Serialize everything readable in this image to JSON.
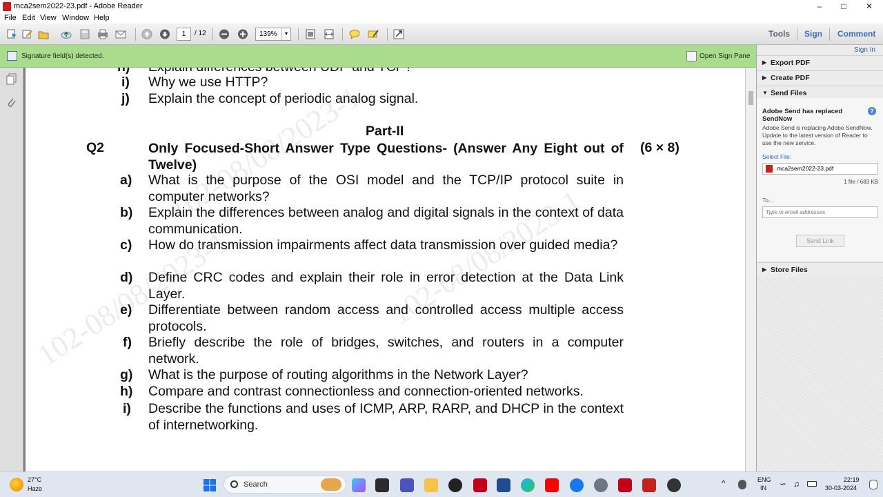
{
  "window": {
    "title": "mca2sem2022-23.pdf - Adobe Reader"
  },
  "menu": [
    "File",
    "Edit",
    "View",
    "Window",
    "Help"
  ],
  "toolbar": {
    "page_current": "1",
    "page_total": "/ 12",
    "zoom": "139%",
    "tools_label": "Tools",
    "sign_label": "Sign",
    "comment_label": "Comment"
  },
  "notification": {
    "message": "Signature field(s) detected.",
    "open_sign_pane": "Open Sign Pane"
  },
  "document": {
    "partial_top": "Explain differences between UDP and TCP?",
    "partial_top_label": "h)",
    "items_top": [
      {
        "label": "i)",
        "text": "Why we use HTTP?"
      },
      {
        "label": "j)",
        "text": "Explain the concept of periodic analog signal."
      }
    ],
    "part_title": "Part-II",
    "question_no": "Q2",
    "question_title": "Only Focused-Short Answer Type Questions- (Answer Any Eight out of Twelve)",
    "marks": "(6 × 8)",
    "items": [
      {
        "label": "a)",
        "text": "What is the purpose of the OSI model and the TCP/IP protocol suite in computer networks?"
      },
      {
        "label": "b)",
        "text": "Explain the differences between analog and digital signals in the context of data communication."
      },
      {
        "label": "c)",
        "text": "How do transmission impairments affect data transmission over guided media?"
      },
      {
        "label": "d)",
        "text": "Define CRC codes and explain their role in error detection at the Data Link Layer."
      },
      {
        "label": "e)",
        "text": "Differentiate between random access and controlled access multiple access protocols."
      },
      {
        "label": "f)",
        "text": "Briefly describe the role of bridges, switches, and routers in a computer network."
      },
      {
        "label": "g)",
        "text": "What is the purpose of routing algorithms in the Network Layer?"
      },
      {
        "label": "h)",
        "text": "Compare and contrast connectionless and connection-oriented networks."
      },
      {
        "label": "i)",
        "text": "Describe the functions and uses of ICMP, ARP, RARP, and DHCP in the context of internetworking."
      }
    ],
    "watermarks": [
      "102-08/08/2023-1",
      "102-08/08/2023-1",
      "102-08/08/2023-1"
    ]
  },
  "right_pane": {
    "sign_in": "Sign In",
    "export_pdf": "Export PDF",
    "create_pdf": "Create PDF",
    "send_files": "Send Files",
    "send_heading": "Adobe Send has replaced SendNow",
    "send_desc": "Adobe Send is replacing Adobe SendNow. Update to the latest version of Reader to use the new service.",
    "select_file_label": "Select File:",
    "file_name": "mca2sem2022-23.pdf",
    "file_size": "1 file / 683 KB",
    "to_label": "To...",
    "email_placeholder": "Type in email addresses",
    "send_link": "Send Link",
    "store_files": "Store Files"
  },
  "taskbar": {
    "temperature": "27°C",
    "weather": "Haze",
    "search": "Search",
    "lang1": "ENG",
    "lang2": "IN",
    "time": "22:19",
    "date": "30-03-2024"
  }
}
